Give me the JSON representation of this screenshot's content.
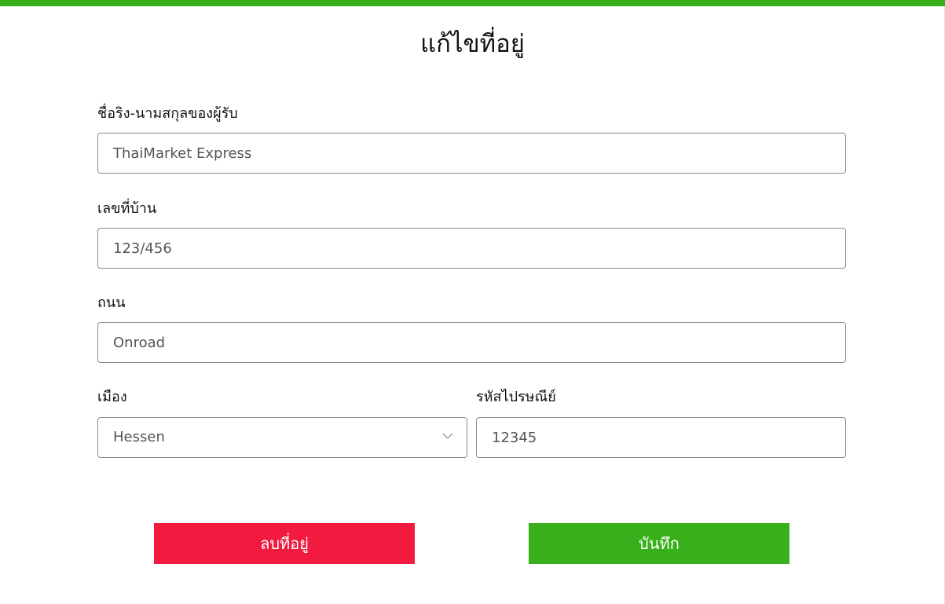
{
  "header": {
    "title": "แก้ไขที่อยู่",
    "accent_color": "#37b01b"
  },
  "form": {
    "recipient_name": {
      "label": "ชื่อริง-นามสกุลของผู้รับ",
      "value": "ThaiMarket Express"
    },
    "house_number": {
      "label": "เลขที่บ้าน",
      "value": "123/456"
    },
    "street": {
      "label": "ถนน",
      "value": "Onroad"
    },
    "city": {
      "label": "เมือง",
      "value": "Hessen",
      "icon": "chevron-down-icon"
    },
    "postal_code": {
      "label": "รหัสไปรษณีย์",
      "value": "12345"
    }
  },
  "actions": {
    "delete_label": "ลบที่อยู่",
    "delete_color": "#f21b3f",
    "save_label": "บันทึก",
    "save_color": "#37b01b"
  }
}
